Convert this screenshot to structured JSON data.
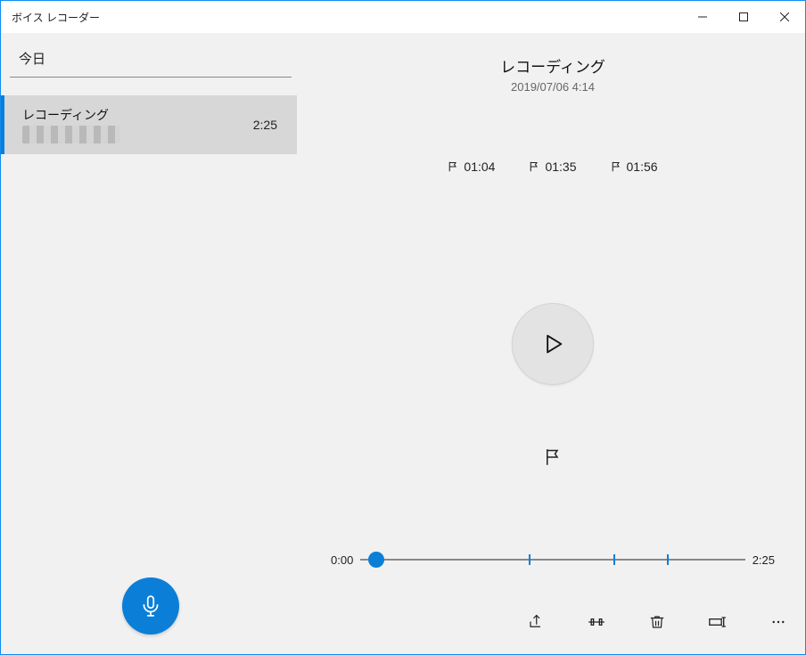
{
  "app": {
    "title": "ボイス レコーダー"
  },
  "sidebar": {
    "section_label": "今日",
    "items": [
      {
        "title": "レコーディング",
        "duration": "2:25"
      }
    ]
  },
  "player": {
    "title": "レコーディング",
    "date": "2019/07/06 4:14",
    "markers": [
      "01:04",
      "01:35",
      "01:56"
    ],
    "current_time": "0:00",
    "total_time": "2:25",
    "progress_pct": 4,
    "marker_pos_pct": [
      44,
      66,
      80
    ]
  },
  "icons": {
    "minimize": "minimize-icon",
    "maximize": "maximize-icon",
    "close": "close-icon",
    "mic": "mic-icon",
    "play": "play-icon",
    "flag": "flag-icon",
    "share": "share-icon",
    "trim": "trim-icon",
    "delete": "delete-icon",
    "rename": "rename-icon",
    "more": "more-icon"
  }
}
